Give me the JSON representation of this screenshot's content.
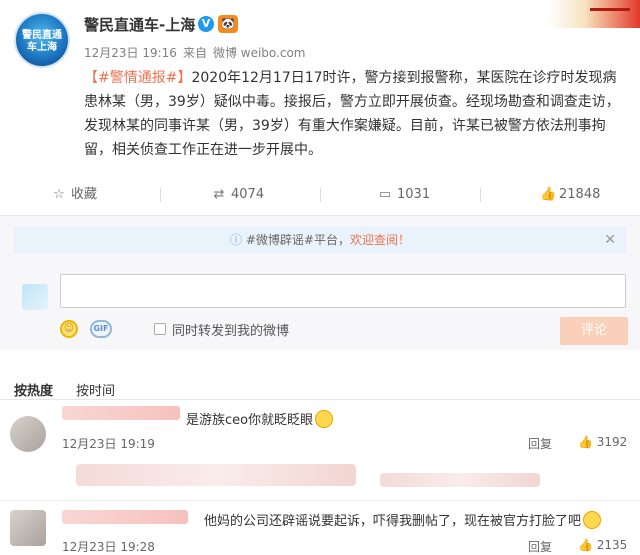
{
  "post": {
    "username": "警民直通车-上海",
    "verified_badge": "V",
    "rank_icon": "🐼",
    "avatar_text": "警民直通车上海",
    "date": "12月23日 19:16",
    "source_prefix": "来自",
    "source": "微博 weibo.com",
    "tag": "【#警情通报#】",
    "body": "2020年12月17日17时许，警方接到报警称，某医院在诊疗时发现病患林某（男，39岁）疑似中毒。接报后，警方立即开展侦查。经现场勘查和调查走访，发现林某的同事许某（男，39岁）有重大作案嫌疑。目前，许某已被警方依法刑事拘留，相关侦查工作正在进一步开展中。"
  },
  "actions": {
    "favorite_label": "收藏",
    "repost_count": "4074",
    "comment_count": "1031",
    "like_count": "21848"
  },
  "comment_box": {
    "notice_prefix": "#微博辟谣#平台，",
    "notice_link": "欢迎查阅！",
    "gif_label": "GIF",
    "repost_checkbox_label": "同时转发到我的微博",
    "submit_label": "评论"
  },
  "sort": {
    "by_hot": "按热度",
    "by_time": "按时间"
  },
  "comments": [
    {
      "text": "是游族ceo你就眨眨眼",
      "time": "12月23日 19:19",
      "reply_label": "回复",
      "likes": "3192"
    },
    {
      "text": "他妈的公司还辟谣说要起诉，吓得我删帖了，现在被官方打脸了吧",
      "time": "12月23日 19:28",
      "reply_label": "回复",
      "likes": "2135"
    }
  ],
  "colors": {
    "accent": "#eb7350",
    "link_blue": "#1a9bf0",
    "submit_disabled": "#fbd0ba"
  }
}
